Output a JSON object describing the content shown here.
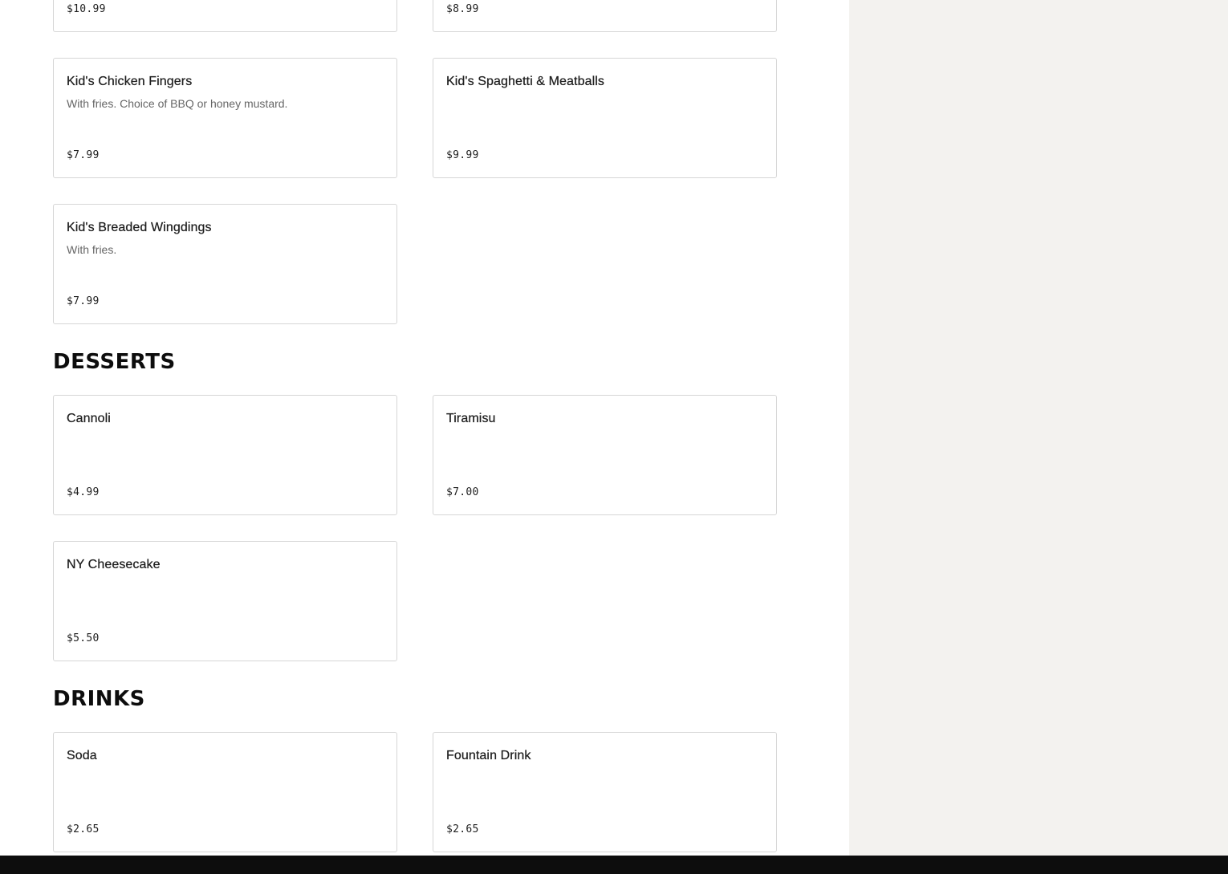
{
  "top_items": [
    {
      "price": "$10.99"
    },
    {
      "price": "$8.99"
    }
  ],
  "kids_items": [
    {
      "name": "Kid's Chicken Fingers",
      "description": "With fries. Choice of BBQ or honey mustard.",
      "price": "$7.99"
    },
    {
      "name": "Kid's Spaghetti & Meatballs",
      "description": "",
      "price": "$9.99"
    },
    {
      "name": "Kid's Breaded Wingdings",
      "description": "With fries.",
      "price": "$7.99"
    }
  ],
  "desserts": {
    "title": "DESSERTS",
    "items": [
      {
        "name": "Cannoli",
        "price": "$4.99"
      },
      {
        "name": "Tiramisu",
        "price": "$7.00"
      },
      {
        "name": "NY Cheesecake",
        "price": "$5.50"
      }
    ]
  },
  "drinks": {
    "title": "DRINKS",
    "items": [
      {
        "name": "Soda",
        "price": "$2.65"
      },
      {
        "name": "Fountain Drink",
        "price": "$2.65"
      }
    ]
  },
  "colors": {
    "sidebar_bg": "#f3f2ef",
    "footer_bg": "#0d0d0d",
    "card_border": "#d6d6d6"
  }
}
